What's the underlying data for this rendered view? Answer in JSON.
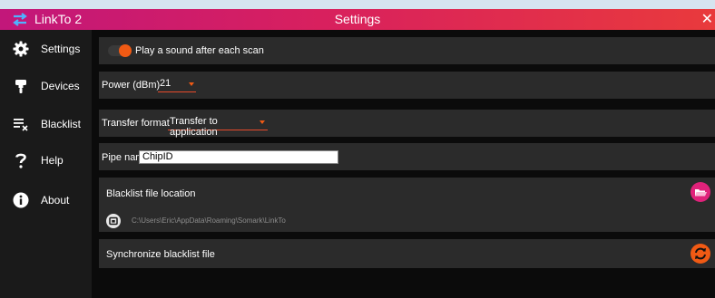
{
  "window": {
    "app_name": "LinkTo 2",
    "title": "Settings",
    "close_glyph": "✕"
  },
  "sidebar": {
    "items": [
      {
        "label": "Settings",
        "icon": "gear-icon"
      },
      {
        "label": "Devices",
        "icon": "rfid-reader-icon"
      },
      {
        "label": "Blacklist",
        "icon": "blacklist-icon"
      },
      {
        "label": "Help",
        "icon": "question-mark-icon"
      },
      {
        "label": "About",
        "icon": "info-icon"
      }
    ]
  },
  "settings": {
    "play_sound": {
      "label": "Play a sound after each scan",
      "enabled": true
    },
    "power": {
      "label": "Power (dBm)",
      "value": "21"
    },
    "transfer_format": {
      "label": "Transfer format",
      "value": "Transfer to application"
    },
    "pipe_name": {
      "label": "Pipe name",
      "value": "ChipID"
    },
    "blacklist_location": {
      "label": "Blacklist file location",
      "path": "C:\\Users\\Eric\\AppData\\Roaming\\Somark\\LinkTo"
    },
    "sync_blacklist": {
      "label": "Synchronize blacklist file"
    }
  },
  "colors": {
    "accent_orange": "#f05a14",
    "accent_pink": "#e0227a",
    "title_gradient_start": "#c2177a",
    "title_gradient_end": "#e93a3c"
  }
}
